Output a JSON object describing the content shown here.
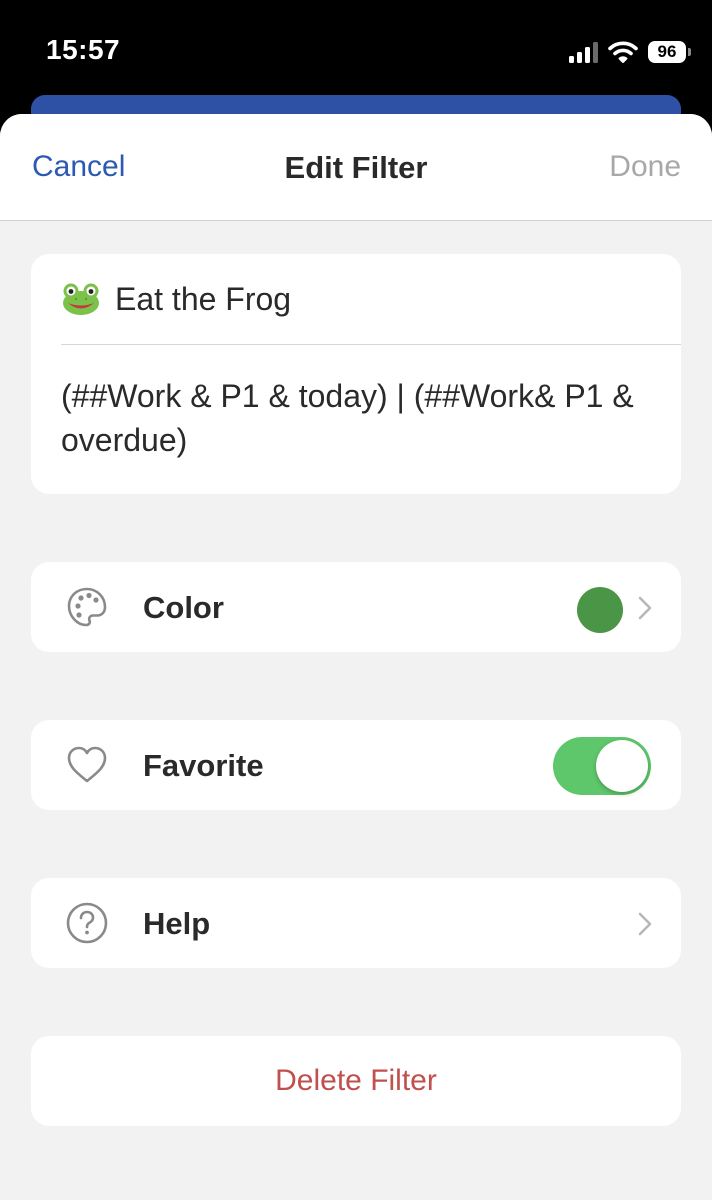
{
  "status_bar": {
    "time": "15:57",
    "battery": "96"
  },
  "nav": {
    "cancel_label": "Cancel",
    "title": "Edit Filter",
    "done_label": "Done"
  },
  "filter": {
    "name": "Eat the Frog",
    "name_icon": "frog-emoji",
    "query": "(##Work & P1 & today) | (##Work& P1 & overdue)"
  },
  "settings": {
    "color": {
      "label": "Color",
      "icon": "palette-icon",
      "value_color": "#4a9646"
    },
    "favorite": {
      "label": "Favorite",
      "icon": "heart-icon",
      "enabled": true
    },
    "help": {
      "label": "Help",
      "icon": "question-circle-icon"
    }
  },
  "delete_label": "Delete Filter",
  "colors": {
    "accent": "#2b59b3",
    "done_disabled": "#a8a8a8",
    "toggle_on": "#5fc76b",
    "destructive": "#c0504d",
    "background": "#f2f2f2"
  }
}
